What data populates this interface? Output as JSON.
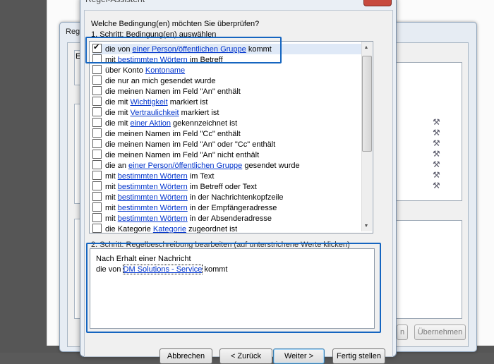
{
  "back_dialog": {
    "title_fragment": "Rege",
    "inner_label": "E",
    "apply_button": "Übernehmen",
    "side_btn_label": "n"
  },
  "wizard": {
    "title": "Regel-Assistent",
    "question": "Welche Bedingung(en) möchten Sie überprüfen?",
    "step1_label": "1. Schritt: Bedingung(en) auswählen",
    "step2_label": "2. Schritt: Regelbeschreibung bearbeiten (auf unterstrichene Werte klicken)",
    "conditions": [
      {
        "checked": true,
        "pre": "die von ",
        "link": "einer Person/öffentlichen Gruppe",
        "post": " kommt"
      },
      {
        "checked": false,
        "pre": "mit ",
        "link": "bestimmten Wörtern",
        "post": " im Betreff"
      },
      {
        "checked": false,
        "pre": "über Konto ",
        "link": "Kontoname",
        "post": ""
      },
      {
        "checked": false,
        "pre": "die nur an mich gesendet wurde",
        "link": "",
        "post": ""
      },
      {
        "checked": false,
        "pre": "die meinen Namen im Feld \"An\" enthält",
        "link": "",
        "post": ""
      },
      {
        "checked": false,
        "pre": "die mit ",
        "link": "Wichtigkeit",
        "post": " markiert ist"
      },
      {
        "checked": false,
        "pre": "die mit ",
        "link": "Vertraulichkeit",
        "post": " markiert ist"
      },
      {
        "checked": false,
        "pre": "die mit ",
        "link": "einer Aktion",
        "post": " gekennzeichnet ist"
      },
      {
        "checked": false,
        "pre": "die meinen Namen im Feld \"Cc\" enthält",
        "link": "",
        "post": ""
      },
      {
        "checked": false,
        "pre": "die meinen Namen im Feld \"An\" oder \"Cc\" enthält",
        "link": "",
        "post": ""
      },
      {
        "checked": false,
        "pre": "die meinen Namen im Feld \"An\" nicht enthält",
        "link": "",
        "post": ""
      },
      {
        "checked": false,
        "pre": "die an ",
        "link": "einer Person/öffentlichen Gruppe",
        "post": " gesendet wurde"
      },
      {
        "checked": false,
        "pre": "mit ",
        "link": "bestimmten Wörtern",
        "post": " im Text"
      },
      {
        "checked": false,
        "pre": "mit ",
        "link": "bestimmten Wörtern",
        "post": " im Betreff oder Text"
      },
      {
        "checked": false,
        "pre": "mit ",
        "link": "bestimmten Wörtern",
        "post": " in der Nachrichtenkopfzeile"
      },
      {
        "checked": false,
        "pre": "mit ",
        "link": "bestimmten Wörtern",
        "post": " in der Empfängeradresse"
      },
      {
        "checked": false,
        "pre": "mit ",
        "link": "bestimmten Wörtern",
        "post": " in der Absenderadresse"
      },
      {
        "checked": false,
        "pre": "die Kategorie ",
        "link": "Kategorie",
        "post": " zugeordnet ist"
      }
    ],
    "description": {
      "line1": "Nach Erhalt einer Nachricht",
      "line2_pre": "die von ",
      "line2_link": "DM Solutions - Service",
      "line2_post": " kommt"
    },
    "buttons": [
      "Abbrechen",
      "< Zurück",
      "Weiter >",
      "Fertig stellen"
    ]
  },
  "colors": {
    "highlight": "#1565c0",
    "link": "#0033cc"
  }
}
